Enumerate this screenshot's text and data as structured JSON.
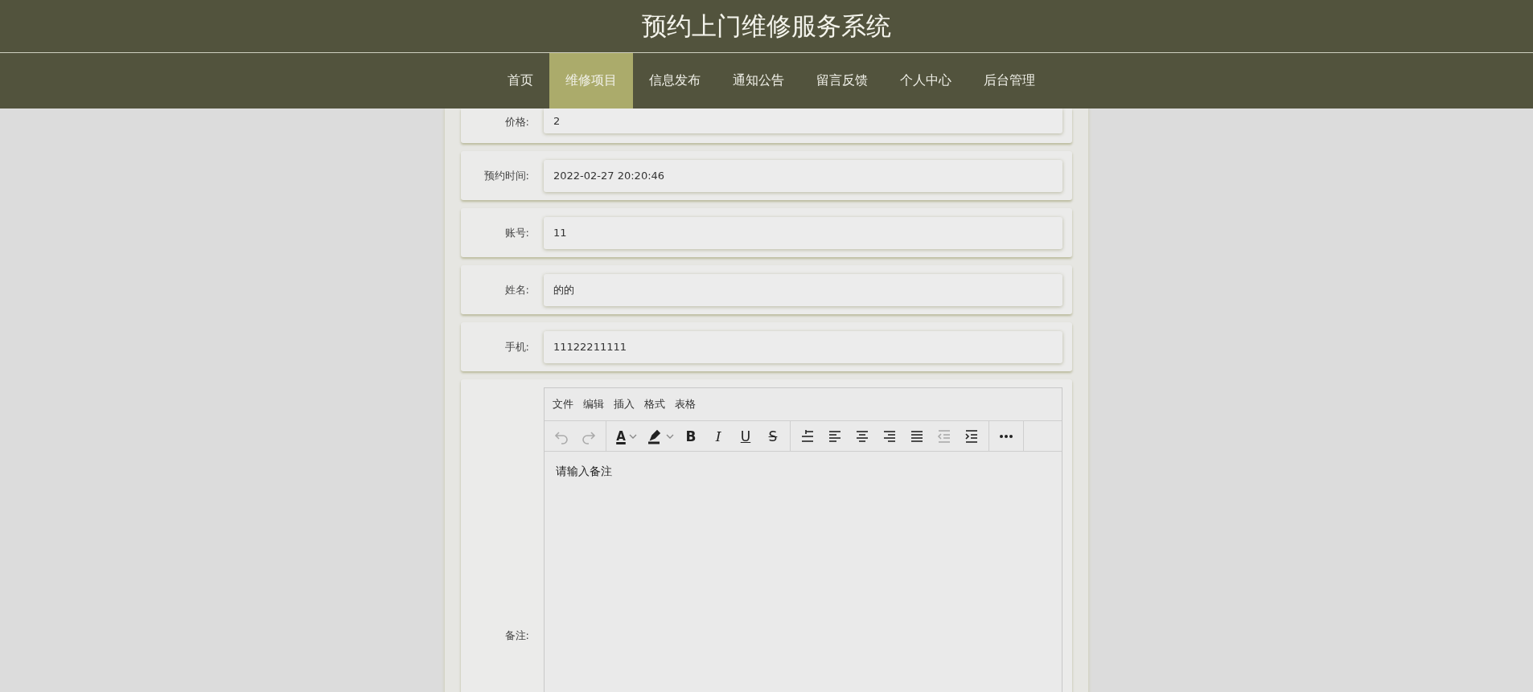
{
  "header": {
    "title": "预约上门维修服务系统"
  },
  "nav": [
    {
      "label": "首页",
      "selected": false
    },
    {
      "label": "维修项目",
      "selected": true
    },
    {
      "label": "信息发布",
      "selected": false
    },
    {
      "label": "通知公告",
      "selected": false
    },
    {
      "label": "留言反馈",
      "selected": false
    },
    {
      "label": "个人中心",
      "selected": false
    },
    {
      "label": "后台管理",
      "selected": false
    }
  ],
  "fields": [
    {
      "label": "价格:",
      "value": "2"
    },
    {
      "label": "预约时间:",
      "value": "2022-02-27 20:20:46"
    },
    {
      "label": "账号:",
      "value": "11"
    },
    {
      "label": "姓名:",
      "value": "的的"
    },
    {
      "label": "手机:",
      "value": "11122211111"
    }
  ],
  "remark": {
    "label": "备注:",
    "menu": [
      "文件",
      "编辑",
      "插入",
      "格式",
      "表格"
    ],
    "toolbar": [
      [
        {
          "kind": "undo",
          "disabled": true
        },
        {
          "kind": "redo",
          "disabled": true
        }
      ],
      [
        {
          "kind": "text-color",
          "text": "A",
          "disabled": false
        },
        {
          "kind": "highlight",
          "disabled": false
        },
        {
          "kind": "bold",
          "text": "B",
          "disabled": false
        },
        {
          "kind": "italic",
          "text": "I",
          "disabled": false
        },
        {
          "kind": "underline",
          "text": "U",
          "disabled": false
        },
        {
          "kind": "strike",
          "text": "S",
          "disabled": false
        }
      ],
      [
        {
          "kind": "line-height",
          "disabled": false
        },
        {
          "kind": "align-left",
          "disabled": false
        },
        {
          "kind": "align-center",
          "disabled": false
        },
        {
          "kind": "align-right",
          "disabled": false
        },
        {
          "kind": "justify",
          "disabled": false
        },
        {
          "kind": "outdent",
          "disabled": true
        },
        {
          "kind": "indent",
          "disabled": false
        }
      ],
      [
        {
          "kind": "more",
          "disabled": false
        }
      ]
    ],
    "placeholder": "请输入备注"
  }
}
